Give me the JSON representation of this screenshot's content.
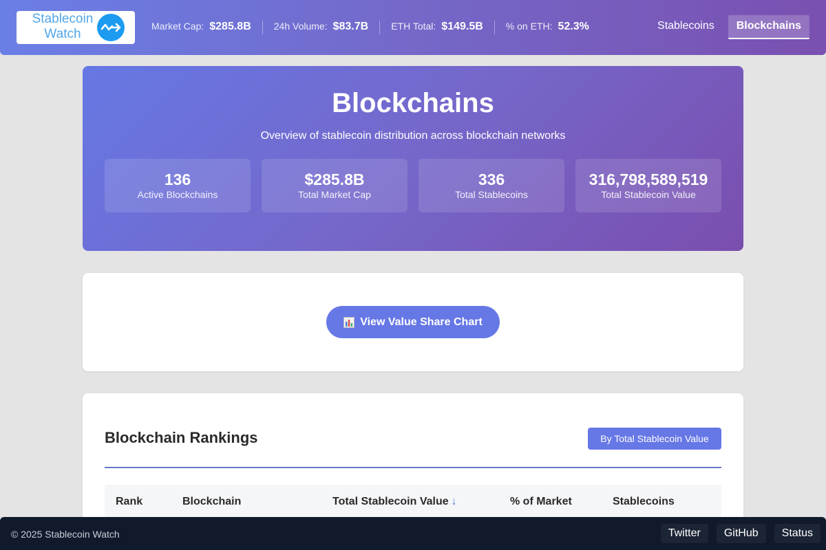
{
  "header": {
    "logo_line1": "Stablecoin",
    "logo_line2": "Watch",
    "stats": [
      {
        "label": "Market Cap:",
        "value": "$285.8B"
      },
      {
        "label": "24h Volume:",
        "value": "$83.7B"
      },
      {
        "label": "ETH Total:",
        "value": "$149.5B"
      },
      {
        "label": "% on ETH:",
        "value": "52.3%"
      }
    ],
    "nav": [
      {
        "label": "Stablecoins",
        "active": false
      },
      {
        "label": "Blockchains",
        "active": true
      }
    ]
  },
  "hero": {
    "title": "Blockchains",
    "subtitle": "Overview of stablecoin distribution across blockchain networks",
    "cards": [
      {
        "value": "136",
        "label": "Active Blockchains"
      },
      {
        "value": "$285.8B",
        "label": "Total Market Cap"
      },
      {
        "value": "336",
        "label": "Total Stablecoins"
      },
      {
        "value": "316,798,589,519",
        "label": "Total Stablecoin Value"
      }
    ]
  },
  "chart_panel": {
    "button_label": "View Value Share Chart",
    "button_icon": "bar-chart-icon"
  },
  "rankings": {
    "title": "Blockchain Rankings",
    "sort_button": "By Total Stablecoin Value",
    "columns": [
      "Rank",
      "Blockchain",
      "Total Stablecoin Value",
      "% of Market",
      "Stablecoins"
    ],
    "sort_arrow": "↓"
  },
  "footer": {
    "copyright": "© 2025 Stablecoin Watch",
    "links": [
      "Twitter",
      "GitHub",
      "Status"
    ]
  },
  "colors": {
    "accent": "#6677e6",
    "logo_blue": "#1c9bf0",
    "footer_bg": "#111a2b"
  }
}
